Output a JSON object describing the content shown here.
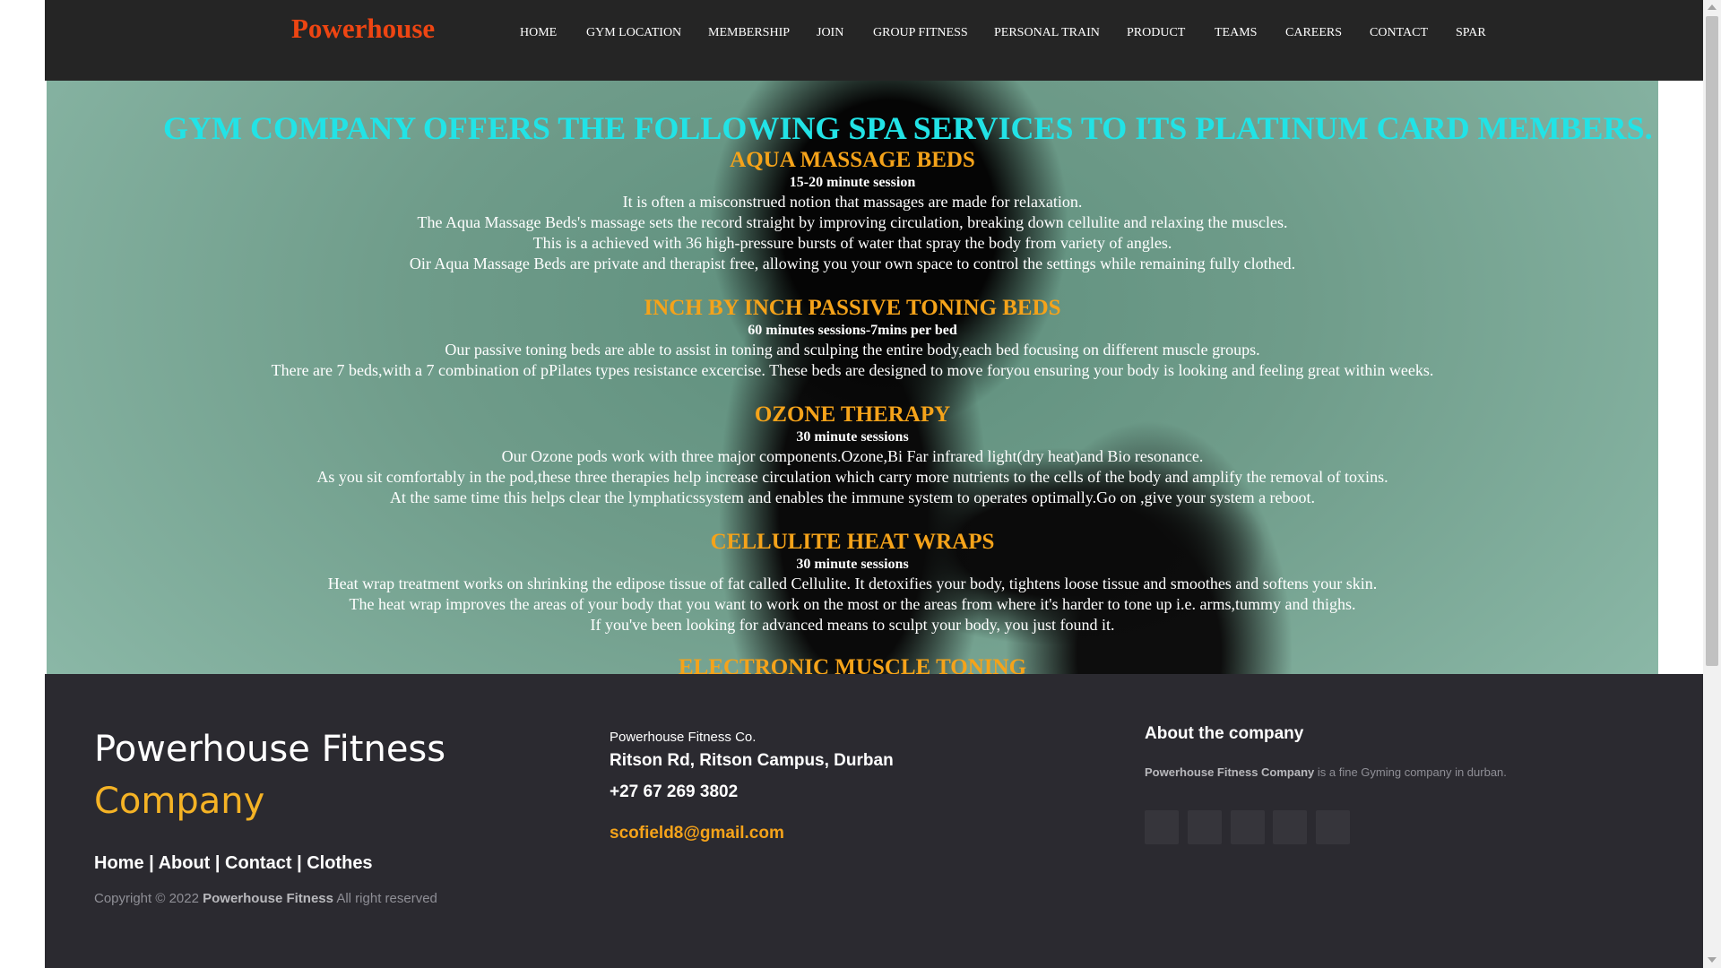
{
  "nav": {
    "brand": "Powerhouse",
    "items": [
      "HOME",
      "GYM LOCATION",
      "MEMBERSHIP",
      "JOIN",
      "GROUP FITNESS",
      "PERSONAL TRAIN",
      "PRODUCT",
      "TEAMS",
      "CAREERS",
      "CONTACT",
      "SPAR"
    ]
  },
  "hero": {
    "title": "GYM COMPANY OFFERS THE FOLLOWING SPA SERVICES TO ITS PLATINUM CARD MEMBERS.",
    "services": [
      {
        "heading": "AQUA MASSAGE BEDS",
        "session": "15-20 minute session",
        "lines": [
          "It is often a misconstrued notion that massages are made for relaxation.",
          "The Aqua Massage Beds's massage sets the record straight by improving circulation, breaking down cellulite and relaxing the muscles.",
          "This is a achieved with 36 high-pressure bursts of water that spray the body from variety of angles.",
          "Oir Aqua Massage Beds are private and therapist free, allowing you your own space to control the settings while remaining fully clothed."
        ]
      },
      {
        "heading": "INCH BY INCH PASSIVE TONING BEDS",
        "session": "60 minutes sessions-7mins per bed",
        "lines": [
          "Our passive toning beds are able to assist in toning and sculping the entire body,each bed focusing on different muscle groups.",
          "There are 7 beds,with a 7 combination of pPilates types resistance excercise. These beds are designed to move foryou ensuring your body is looking and feeling great within weeks."
        ]
      },
      {
        "heading": "OZONE THERAPY",
        "session": "30 minute sessions",
        "lines": [
          "Our Ozone pods work with three major components.Ozone,Bi Far infrared light(dry heat)and Bio resonance.",
          "As you sit comfortably in the pod,these three therapies help increase circulation which carry more nutrients to the cells of the body and amplify the removal of toxins.",
          "At the same time this helps clear the lymphaticssystem and enables the immune system to operates optimally.Go on ,give your system a reboot."
        ]
      },
      {
        "heading": "CELLULITE HEAT WRAPS",
        "session": "30 minute sessions",
        "lines": [
          "Heat wrap treatment works on shrinking the edipose tissue of fat called Cellulite. It detoxifies your body, tightens loose tissue and smoothes and softens your skin.",
          "The heat wrap improves the areas of your body that you want to work on the most or the areas from where it's harder to tone up i.e. arms,tummy and thighs.",
          "If you've been looking for advanced means to sculpt your body, you just found it."
        ]
      },
      {
        "heading": "ELECTRONIC MUSCLE TONING",
        "session": "",
        "lines": []
      }
    ]
  },
  "footer": {
    "brand_line1": "Powerhouse Fitness",
    "brand_line2": "Company",
    "links": [
      "Home",
      "About",
      "Contact",
      "Clothes"
    ],
    "copyright_prefix": "Copyright © 2022",
    "copyright_name": "Powerhouse Fitness",
    "copyright_suffix": "All right reserved",
    "company_name": "Powerhouse Fitness Co.",
    "address": "Ritson Rd, Ritson Campus, Durban",
    "phone": "+27 67 269 3802",
    "email": "scofield8@gmail.com",
    "about_heading": "About the company",
    "about_name": "Powerhouse Fitness Company",
    "about_text": "is a fine Gyming company in durban.",
    "social_icons": [
      "social-icon-1",
      "social-icon-2",
      "social-icon-3",
      "social-icon-4",
      "social-icon-5"
    ]
  }
}
